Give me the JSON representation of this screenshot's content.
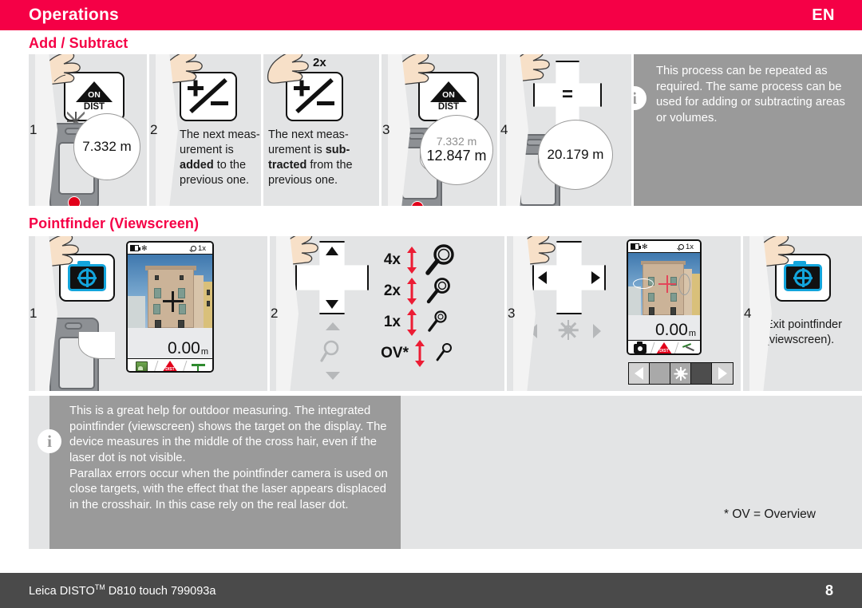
{
  "header": {
    "title": "Operations",
    "language": "EN"
  },
  "sections": [
    {
      "id": "add-subtract",
      "title": "Add / Subtract"
    },
    {
      "id": "pointfinder",
      "title": "Pointfinder (Viewscreen)"
    }
  ],
  "add_subtract": {
    "steps": [
      {
        "number": "1",
        "key_label_top": "ON",
        "key_label_bottom": "DIST",
        "measurement": "7.332 m"
      },
      {
        "number": "2",
        "key_icon": "plus-minus-key",
        "text_plain_1": "The next meas-",
        "text_plain_2": "urement is ",
        "text_bold": "added",
        "text_plain_3": " to the previous one."
      },
      {
        "number": "",
        "press_count": "2x",
        "key_icon": "plus-minus-key",
        "text_plain_1": "The next meas-",
        "text_plain_2": "urement is ",
        "text_bold": "sub-tracted",
        "text_plain_3": " from the previous one."
      },
      {
        "number": "3",
        "key_label_top": "ON",
        "key_label_bottom": "DIST",
        "measurement_prev": "7.332 m",
        "measurement": "12.847 m"
      },
      {
        "number": "4",
        "key_icon": "equals-plus-key",
        "measurement": "20.179 m"
      }
    ],
    "info": "This process can be repeated as required. The same process can be used for adding or subtracting areas or volumes."
  },
  "pointfinder": {
    "steps": [
      {
        "number": "1",
        "key_icon": "pointfinder-camera-key",
        "screen": {
          "zoom_label": "1x",
          "value": "0.00",
          "unit": "m",
          "tabs": [
            "gallery-icon",
            "dist-icon",
            "tripod-icon"
          ]
        }
      },
      {
        "number": "2",
        "key_icon": "dpad-up-down-key",
        "hint_icons": [
          "triangle-up-icon",
          "magnifier-icon",
          "triangle-down-icon"
        ],
        "zoom_levels": [
          {
            "label": "4x",
            "size": "large"
          },
          {
            "label": "2x",
            "size": "medium"
          },
          {
            "label": "1x",
            "size": "small"
          },
          {
            "label": "OV*",
            "size": "tiny"
          }
        ]
      },
      {
        "number": "3",
        "key_icon": "dpad-left-right-key",
        "hint_icons": [
          "triangle-left-icon",
          "brightness-sun-icon",
          "triangle-right-icon"
        ],
        "screen": {
          "zoom_label": "1x",
          "value": "0.00",
          "unit": "m",
          "tabs": [
            "camera-icon",
            "dist-icon",
            "bird-icon"
          ]
        },
        "keystrip": [
          "arrow-left-icon",
          "",
          "brightness-sun-icon",
          "",
          "arrow-right-icon"
        ]
      },
      {
        "number": "4",
        "key_icon": "pointfinder-camera-key",
        "text_line_1": "Exit pointfinder",
        "text_line_2": "(viewscreen)."
      }
    ],
    "info": "This is a great help for outdoor measuring. The integrated pointfinder (viewscreen) shows the target on the display. The device measures in the middle of the cross hair, even if the laser dot is not visible.\nParallax errors occur when the pointfinder camera is used on close targets, with the effect that the laser appears displaced in the crosshair. In this case rely on the real laser dot.",
    "footnote": "* OV = Overview"
  },
  "footer": {
    "product": "Leica DISTO",
    "trademark": "TM",
    "model": " D810 touch 799093a",
    "page": "8"
  },
  "colors": {
    "brand_red": "#f50046",
    "panel_grey": "#e3e4e5",
    "info_grey": "#9a9a9a",
    "footer_grey": "#4a4a4a",
    "accent_blue": "#13a5dc",
    "arrow_red": "#ec1c34"
  }
}
